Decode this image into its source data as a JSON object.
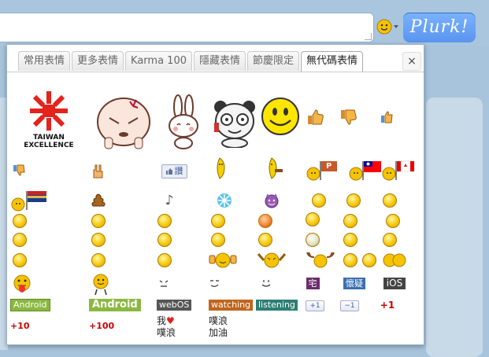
{
  "composer": {
    "plurk_label": "Plurk!"
  },
  "tabs": [
    {
      "label": "常用表情"
    },
    {
      "label": "更多表情"
    },
    {
      "label": "Karma 100"
    },
    {
      "label": "隱藏表情"
    },
    {
      "label": "節慶限定"
    },
    {
      "label": "無代碼表情"
    }
  ],
  "active_tab": 5,
  "close_label": "×",
  "emoticons": {
    "taiwan_logo_line1": "TAIWAN",
    "taiwan_logo_line2": "EXCELLENCE",
    "like_label": "讚",
    "flag_p": "P",
    "badge_zhai": "宅",
    "badge_huaiyi": "懷疑",
    "badge_ios": "iOS",
    "badge_android_small": "Android",
    "badge_android_big": "Android",
    "badge_webos": "webOS",
    "badge_watching": "watching",
    "badge_listening": "listening",
    "badge_plus1": "+1",
    "badge_minus1": "−1",
    "red_plus1": "+1",
    "red_plus10": "+10",
    "red_plus100": "+100",
    "text_woai_line1": "我",
    "text_woai_line2": "噗浪",
    "heart": "♥",
    "text_jiayou_line1": "噗浪",
    "text_jiayou_line2": "加油",
    "note": "♪"
  },
  "colors": {
    "plurk_blue": "#6aa3f8",
    "taiwan_red": "#e3231c",
    "android_green": "#8bb83f",
    "watching_orange": "#c0651b",
    "listening_teal": "#2d7e74",
    "badge_purple": "#6b2d6d",
    "badge_blue": "#3a6fb0",
    "badge_dark": "#444"
  }
}
